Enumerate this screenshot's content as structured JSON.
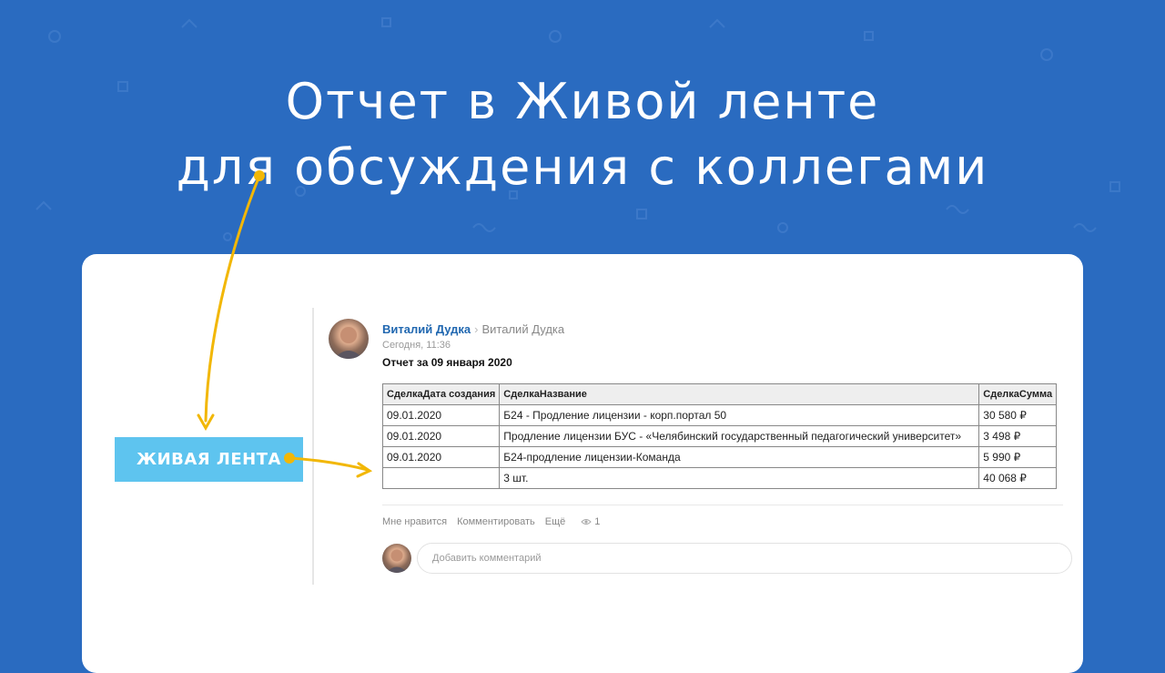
{
  "headline": {
    "line1": "Отчет в Живой ленте",
    "line2": "для обсуждения с коллегами"
  },
  "live_feed_button": {
    "label": "ЖИВАЯ ЛЕНТА"
  },
  "post": {
    "author": "Виталий Дудка",
    "recipient": "Виталий Дудка",
    "time": "Сегодня, 11:36",
    "title": "Отчет за 09 января 2020",
    "table": {
      "headers": [
        "СделкаДата создания",
        "СделкаНазвание",
        "СделкаСумма"
      ],
      "rows": [
        [
          "09.01.2020",
          "Б24 - Продление лицензии - корп.портал 50",
          "30 580 ₽"
        ],
        [
          "09.01.2020",
          "Продление лицензии БУС - «Челябинский государственный педагогический университет»",
          "3 498 ₽"
        ],
        [
          "09.01.2020",
          "Б24-продление лицензии-Команда",
          "5 990 ₽"
        ]
      ],
      "total": [
        "",
        "3 шт.",
        "40 068 ₽"
      ]
    },
    "actions": {
      "like": "Мне нравится",
      "comment": "Комментировать",
      "more": "Ещё",
      "views": "1"
    },
    "comment_placeholder": "Добавить комментарий"
  },
  "colors": {
    "background": "#2a6bc0",
    "button": "#5ec4ef",
    "arrow": "#f2b705",
    "author_link": "#2067b0"
  },
  "icons": [
    "eye-icon",
    "chevron-right-icon"
  ]
}
